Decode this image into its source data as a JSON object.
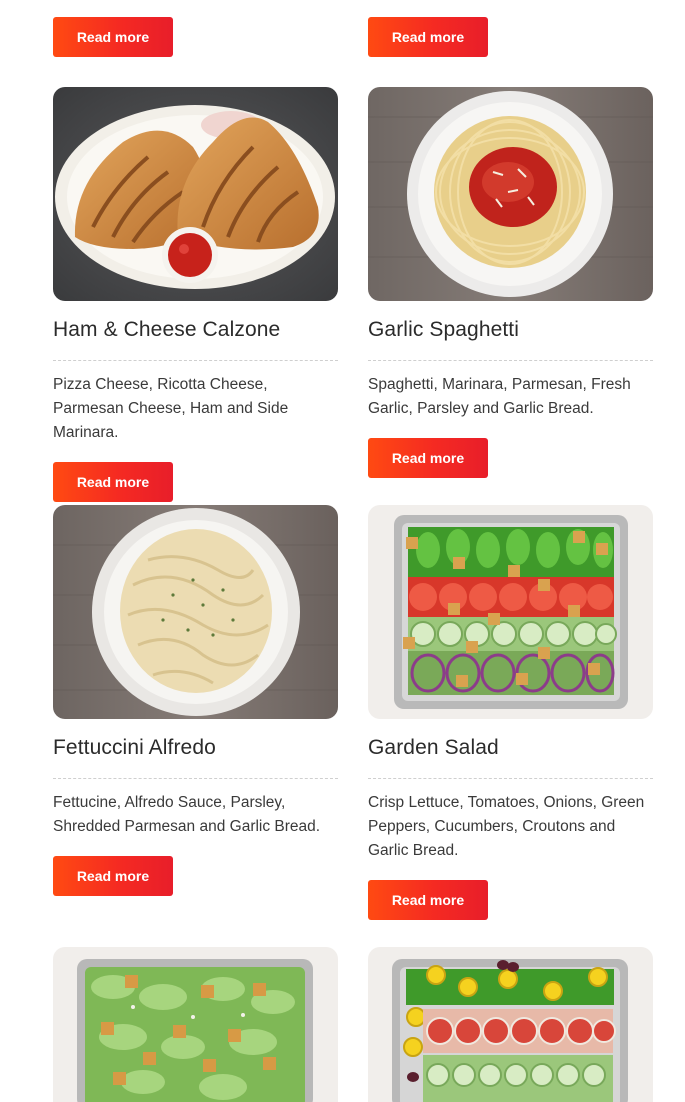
{
  "top_buttons": [
    {
      "label": "Read more"
    },
    {
      "label": "Read more"
    }
  ],
  "menu_items": [
    {
      "title": "Ham & Cheese Calzone",
      "description": "Pizza Cheese, Ricotta Cheese, Parmesan Cheese, Ham and Side Marinara.",
      "button_label": "Read more"
    },
    {
      "title": "Garlic Spaghetti",
      "description": "Spaghetti, Marinara, Parmesan, Fresh Garlic, Parsley and Garlic Bread.",
      "button_label": "Read more"
    },
    {
      "title": "Fettuccini Alfredo",
      "description": "Fettucine, Alfredo Sauce, Parsley, Shredded Parmesan and Garlic Bread.",
      "button_label": "Read more"
    },
    {
      "title": "Garden Salad",
      "description": "Crisp Lettuce, Tomatoes, Onions, Green Peppers, Cucumbers, Croutons and Garlic Bread.",
      "button_label": "Read more"
    }
  ],
  "colors": {
    "button_start": "#ff4a12",
    "button_end": "#e81e2a",
    "title_text": "#2b2b2b",
    "body_text": "#3a3a3a"
  }
}
